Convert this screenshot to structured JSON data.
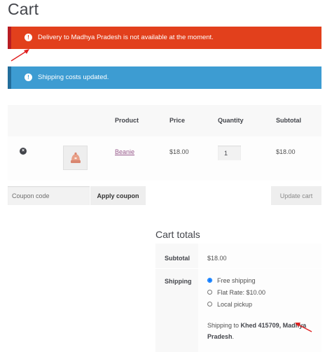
{
  "page": {
    "title": "Cart"
  },
  "notices": {
    "error": {
      "icon": "exclamation-circle-icon",
      "text": "Delivery to Madhya Pradesh is not available at the moment.",
      "color": "#e2401c"
    },
    "info": {
      "icon": "exclamation-circle-icon",
      "text": "Shipping costs updated.",
      "color": "#3d9cd2"
    }
  },
  "annotation_color": "#e02020",
  "cart": {
    "columns": {
      "product": "Product",
      "price": "Price",
      "quantity": "Quantity",
      "subtotal": "Subtotal"
    },
    "items": [
      {
        "name": "Beanie",
        "price": "$18.00",
        "quantity": "1",
        "subtotal": "$18.00",
        "thumb_icon": "beanie-hat-icon",
        "remove_icon": "remove-x-icon"
      }
    ]
  },
  "actions": {
    "coupon_placeholder": "Coupon code",
    "apply_label": "Apply coupon",
    "update_label": "Update cart"
  },
  "totals": {
    "title": "Cart totals",
    "subtotal_label": "Subtotal",
    "subtotal_value": "$18.00",
    "shipping_label": "Shipping",
    "shipping_options": [
      {
        "label": "Free shipping",
        "checked": true
      },
      {
        "label": "Flat Rate: $10.00",
        "checked": false
      },
      {
        "label": "Local pickup",
        "checked": false
      }
    ],
    "shipping_to_prefix": "Shipping to ",
    "shipping_to_address_line1": "Khed 415709, Madhya",
    "shipping_to_address_line2": "Pradesh",
    "shipping_to_suffix": "."
  }
}
